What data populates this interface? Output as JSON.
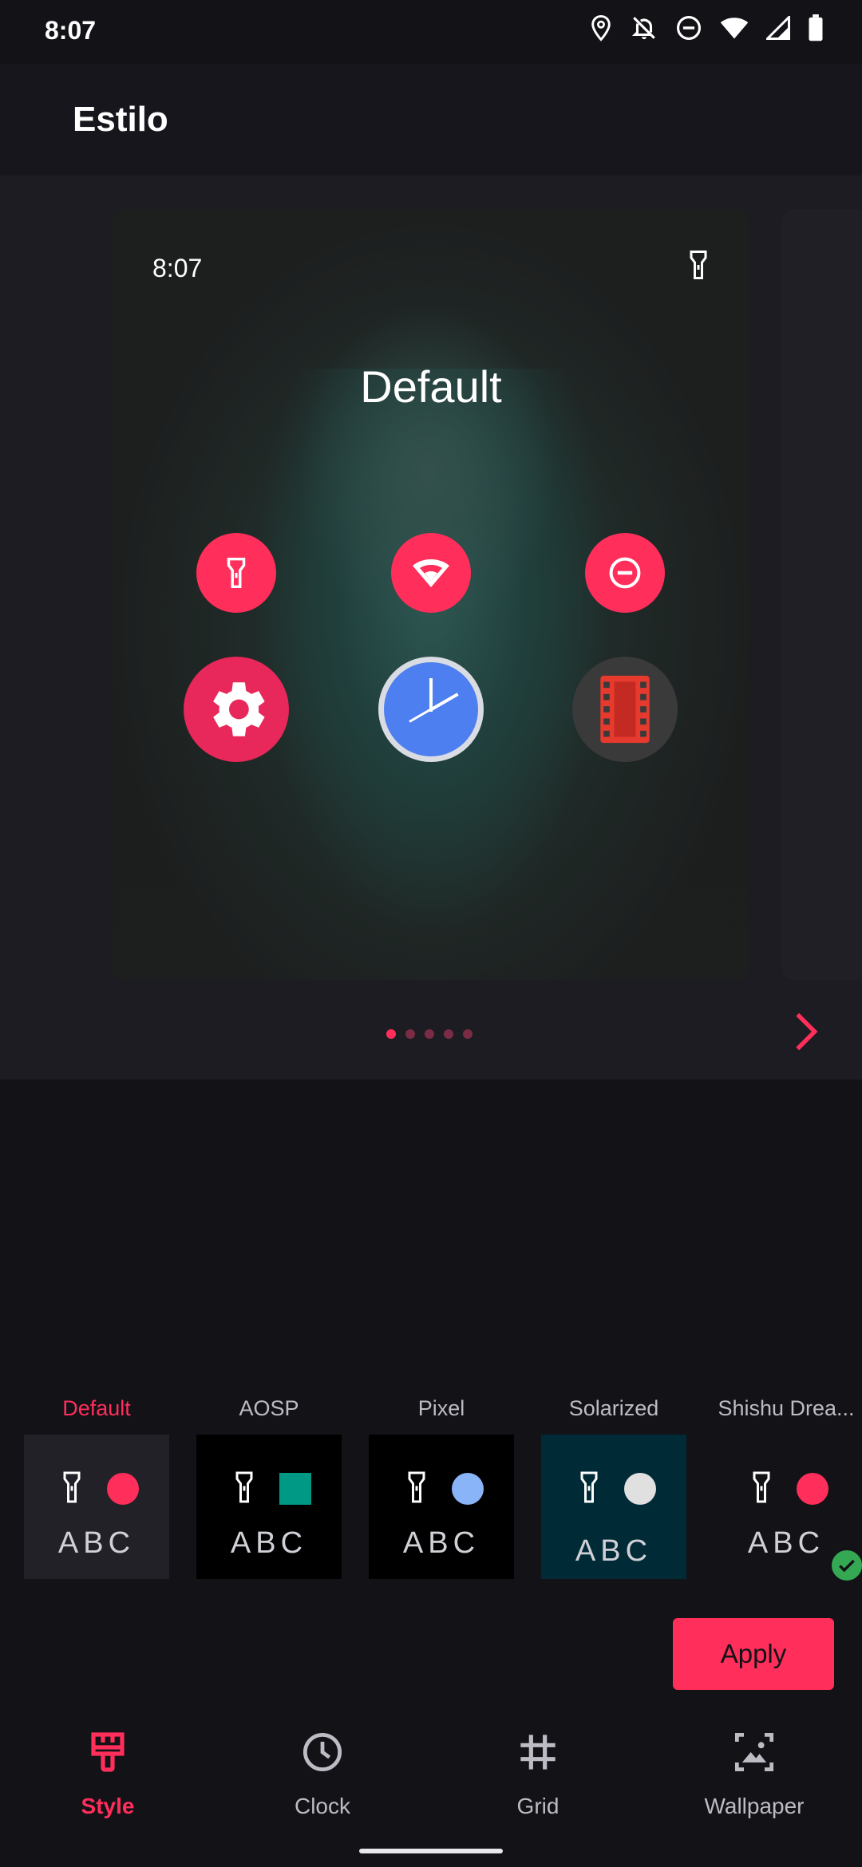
{
  "status_bar": {
    "time": "8:07",
    "icons": [
      "location-icon",
      "alarm-off-icon",
      "do-not-disturb-icon",
      "wifi-icon",
      "signal-icon",
      "battery-icon"
    ]
  },
  "app_bar": {
    "title": "Estilo"
  },
  "preview": {
    "time": "8:07",
    "title": "Default",
    "quick_settings": [
      "flashlight-icon",
      "wifi-icon",
      "do-not-disturb-icon"
    ],
    "apps": [
      "settings-app-icon",
      "clock-app-icon",
      "video-app-icon"
    ],
    "page_count": 5,
    "active_page": 1
  },
  "options": [
    {
      "label": "Default",
      "selected": true,
      "bg": "#222127",
      "shape": "circle",
      "color": "#ff2e5b",
      "sample": "ABC"
    },
    {
      "label": "AOSP",
      "selected": false,
      "bg": "#000000",
      "shape": "square",
      "color": "#009985",
      "sample": "ABC"
    },
    {
      "label": "Pixel",
      "selected": false,
      "bg": "#000000",
      "shape": "circle",
      "color": "#8ab4f8",
      "sample": "ABC"
    },
    {
      "label": "Solarized",
      "selected": false,
      "bg": "#002b36",
      "shape": "circle",
      "color": "#e0e0e0",
      "sample": "ABC"
    },
    {
      "label": "Shishu Drea...",
      "selected": false,
      "bg": "#131217",
      "shape": "circle",
      "color": "#ff2e5b",
      "sample": "ABC"
    }
  ],
  "apply_label": "Apply",
  "nav": {
    "items": [
      {
        "label": "Style",
        "icon": "brush-icon",
        "active": true
      },
      {
        "label": "Clock",
        "icon": "clock-icon",
        "active": false
      },
      {
        "label": "Grid",
        "icon": "grid-icon",
        "active": false
      },
      {
        "label": "Wallpaper",
        "icon": "wallpaper-icon",
        "active": false
      }
    ]
  },
  "colors": {
    "accent": "#ff2e5b",
    "background": "#131217"
  }
}
